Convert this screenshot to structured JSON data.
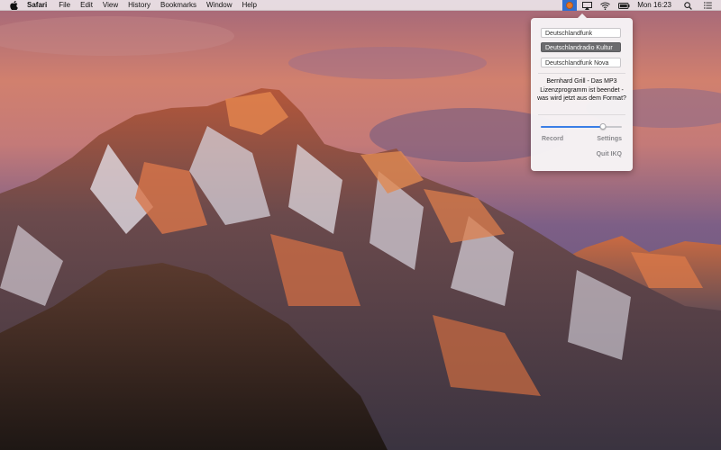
{
  "menubar": {
    "app_name": "Safari",
    "menus": [
      "File",
      "Edit",
      "View",
      "History",
      "Bookmarks",
      "Window",
      "Help"
    ],
    "clock": "Mon 16:23",
    "icons": [
      "apple-icon",
      "iq-status-icon",
      "airplay-icon",
      "wifi-icon",
      "battery-icon",
      "spotlight-icon",
      "notification-center-icon"
    ]
  },
  "popover": {
    "stations": [
      "Deutschlandfunk",
      "Deutschlandradio Kultur",
      "Deutschlandfunk Nova"
    ],
    "active_station": 1,
    "now_playing": "Bernhard Grill - Das MP3 Lizenzprogramm ist beendet - was wird jetzt aus dem Format?",
    "volume": 0.77,
    "record_label": "Record",
    "settings_label": "Settings",
    "quit_label": "Quit IKQ"
  },
  "colors": {
    "accent": "#3a7ee6",
    "status_highlight": "#2f6fd0",
    "active_station_bg": "#6b6b6e"
  }
}
